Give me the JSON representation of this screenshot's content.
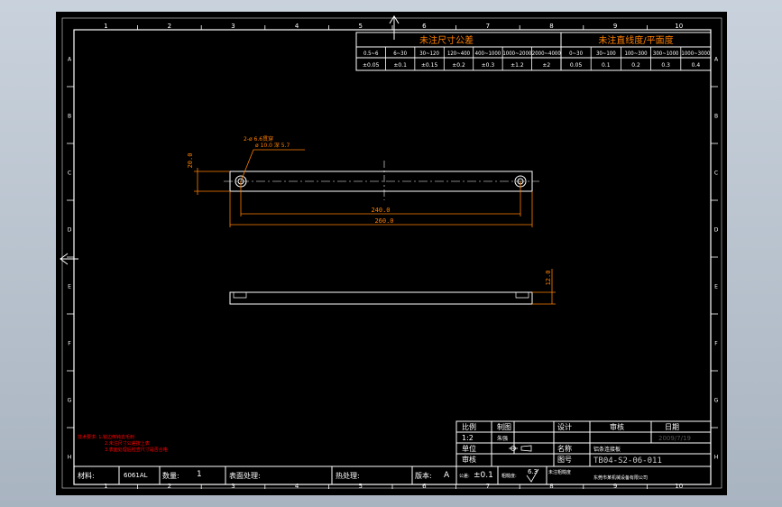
{
  "colors": {
    "background": "#000000",
    "frame": "#ffffff",
    "tolerance_header": "#ff8000",
    "dimension": "#ff8000",
    "note": "#ff0000",
    "title_block_text": "#ffffff"
  },
  "border": {
    "column_numbers": [
      "1",
      "2",
      "3",
      "4",
      "5",
      "6",
      "7",
      "8",
      "9",
      "10"
    ],
    "row_letters": [
      "A",
      "B",
      "C",
      "D",
      "E",
      "F",
      "G",
      "H"
    ]
  },
  "tolerance_table": {
    "linear_header": "未注尺寸公差",
    "flatness_header": "未注直线度/平面度",
    "linear_ranges": [
      "0.5~6",
      "6~30",
      "30~120",
      "120~400",
      "400~1000",
      "1000~2000",
      "2000~4000"
    ],
    "linear_values": [
      "±0.05",
      "±0.1",
      "±0.15",
      "±0.2",
      "±0.3",
      "±1.2",
      "±2"
    ],
    "flatness_ranges": [
      "0~30",
      "30~100",
      "100~300",
      "300~1000",
      "1000~3000"
    ],
    "flatness_values": [
      "0.05",
      "0.1",
      "0.2",
      "0.3",
      "0.4"
    ]
  },
  "dimensions": {
    "height_top_view": "20.0",
    "hole_spacing": "240.0",
    "overall_length": "260.0",
    "side_height": "12.0",
    "hole_callout_line1": "2-ø 6.6贯穿",
    "hole_callout_line2": "ø 10.0 深 5.7"
  },
  "notes": {
    "line1": "技术要求: 1.锐边倒钝去毛刺",
    "line2": "2.未注尺寸公差按上表",
    "line3": "3.表面处理后检查尺寸是否合格"
  },
  "title_block": {
    "scale_label": "比例",
    "scale_value": "1:2",
    "drawn_label": "制图",
    "drawn_value": "朱强",
    "design_label": "设计",
    "review_label": "审核",
    "date_label": "日期",
    "date_value": "2009/7/19",
    "unit_label": "单位",
    "name_label": "名称",
    "name_value": "铝条连接板",
    "approve_label": "审核",
    "drawing_no_label": "图号",
    "drawing_no_value": "TB04-S2-06-011",
    "company_label": "东莞市某机械设备有限公司",
    "material_label": "材料:",
    "material_value": "6061AL",
    "quantity_label": "数量:",
    "quantity_value": "1",
    "surface_label": "表面处理:",
    "heat_label": "热处理:",
    "version_label": "版本:",
    "version_value": "A",
    "tolerance_label": "公差:",
    "tolerance_value": "±0.1",
    "roughness_label": "粗糙度:",
    "roughness_value": "6.3",
    "unmarked_label": "未注粗糙度"
  }
}
